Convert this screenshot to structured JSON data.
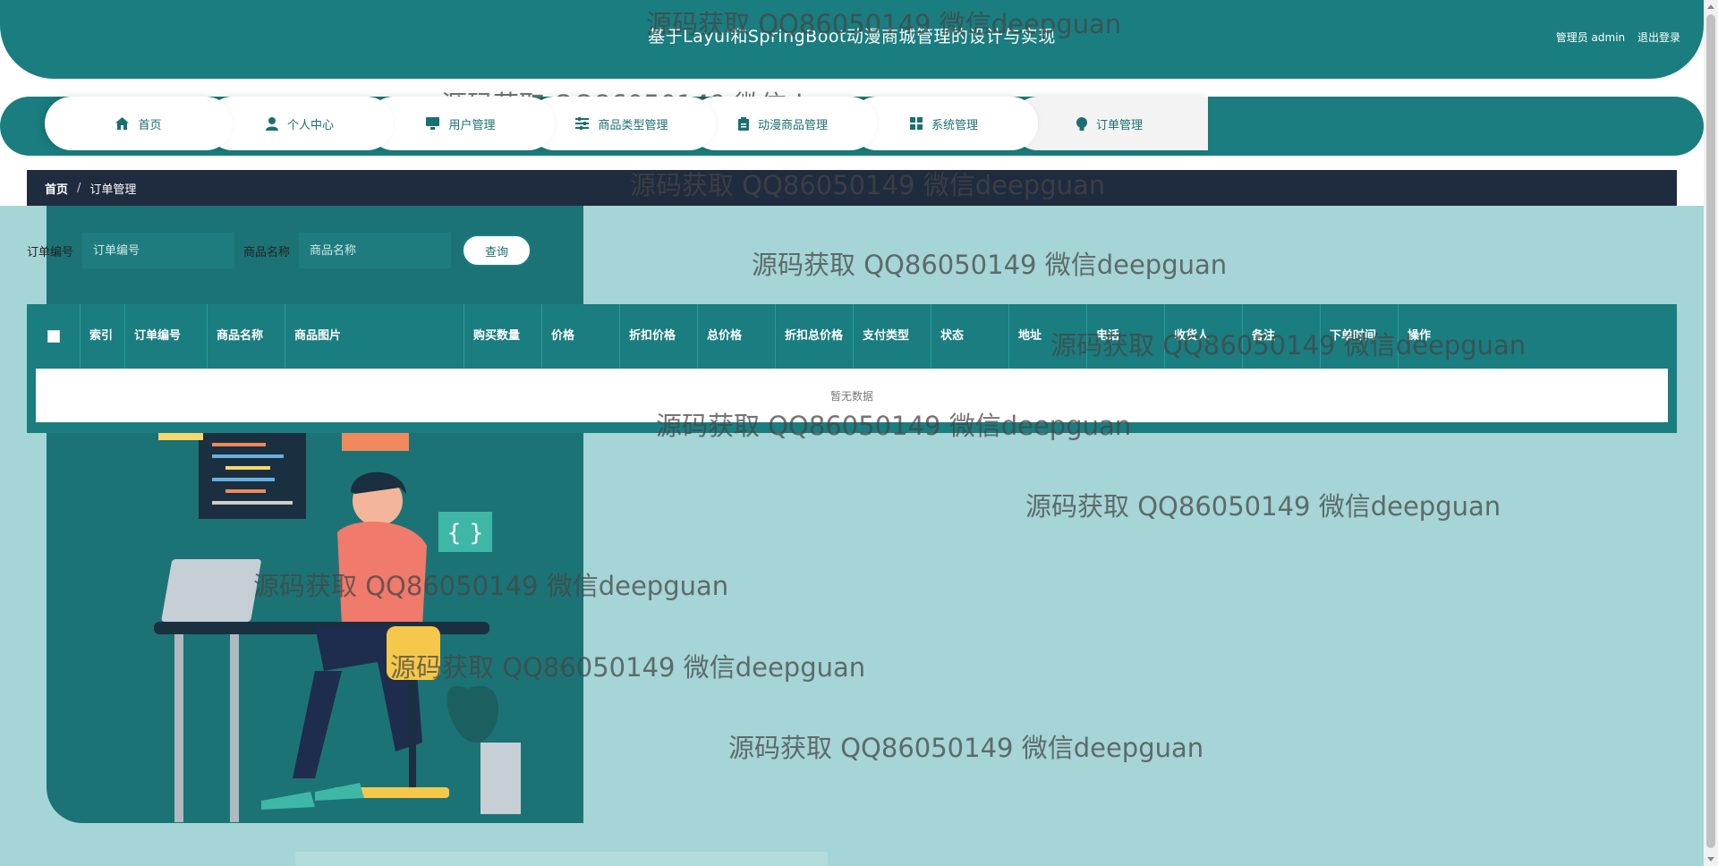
{
  "header": {
    "title": "基于Layui和SpringBoot动漫商城管理的设计与实现",
    "user_label": "管理员 admin",
    "logout_label": "退出登录"
  },
  "nav": {
    "items": [
      {
        "label": "首页",
        "icon": "home-icon"
      },
      {
        "label": "个人中心",
        "icon": "user-icon"
      },
      {
        "label": "用户管理",
        "icon": "monitor-icon"
      },
      {
        "label": "商品类型管理",
        "icon": "sliders-icon"
      },
      {
        "label": "动漫商品管理",
        "icon": "clipboard-icon"
      },
      {
        "label": "系统管理",
        "icon": "grid-icon"
      },
      {
        "label": "订单管理",
        "icon": "bulb-icon"
      }
    ]
  },
  "breadcrumb": {
    "home": "首页",
    "separator": "/",
    "current": "订单管理"
  },
  "search": {
    "order_no_label": "订单编号",
    "order_no_placeholder": "订单编号",
    "product_name_label": "商品名称",
    "product_name_placeholder": "商品名称",
    "query_button": "查询"
  },
  "table": {
    "columns": [
      "索引",
      "订单编号",
      "商品名称",
      "商品图片",
      "购买数量",
      "价格",
      "折扣价格",
      "总价格",
      "折扣总价格",
      "支付类型",
      "状态",
      "地址",
      "电话",
      "收货人",
      "备注",
      "下单时间",
      "操作"
    ],
    "empty_text": "暂无数据"
  },
  "watermark": {
    "text": "源码获取 QQ86050149 微信deepguan"
  },
  "colors": {
    "primary": "#1a7d7f",
    "breadcrumb_bg": "#1f2b3f",
    "content_bg": "#a5d5d6"
  }
}
